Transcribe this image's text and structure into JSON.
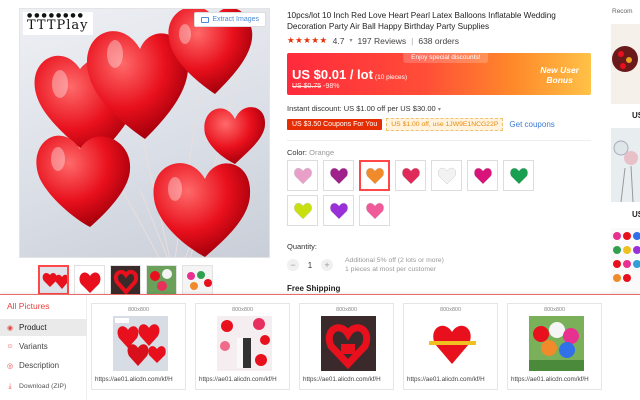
{
  "gallery": {
    "brand": "TTTPlay",
    "brand_dots": "●●●●●●●●",
    "extract_button": "Extract Images"
  },
  "product": {
    "title": "10pcs/lot 10 Inch Red Love Heart Pearl Latex Balloons Inflatable Wedding Decoration Party Air Ball Happy Birthday Party Supplies",
    "stars": "★★★★★",
    "rating": "4.7",
    "reviews": "197 Reviews",
    "orders": "638 orders"
  },
  "price": {
    "banner": "Enjoy special discounts!",
    "current": "US $0.01 / lot",
    "pieces": "(10 pieces)",
    "original": "US $0.75",
    "discount": "-98%",
    "new_user_line1": "New User",
    "new_user_line2": "Bonus"
  },
  "coupons": {
    "instant": "Instant discount: US $1.00 off per US $30.00",
    "red_coupon": "US $3.50 Coupons For You",
    "code_coupon": "US $1.00 off, use 1JW9E1NCG22P",
    "get_coupons": "Get coupons"
  },
  "color": {
    "label": "Color:",
    "selected": "Orange",
    "swatch_colors": [
      "#e8a0c8",
      "#a0208c",
      "#f08a2a",
      "#e02a5a",
      "#f2f2f2",
      "#d8147a",
      "#18a050",
      "#c8e010",
      "#9a30d8",
      "#f05a9a"
    ]
  },
  "quantity": {
    "label": "Quantity:",
    "minus": "−",
    "value": "1",
    "plus": "+",
    "note_line1": "Additional 5% off (2 lots or more)",
    "note_line2": "1 pieces at most per customer"
  },
  "shipping": {
    "label": "Free Shipping"
  },
  "sidebar": {
    "label": "Recom",
    "us_labels": [
      "US",
      "US"
    ]
  },
  "panel": {
    "title": "All Pictures",
    "nav": [
      {
        "label": "Product",
        "icon": "image-icon"
      },
      {
        "label": "Variants",
        "icon": "variants-icon"
      },
      {
        "label": "Description",
        "icon": "description-icon"
      },
      {
        "label": "Download (ZIP)",
        "icon": "download-icon"
      }
    ],
    "cards": [
      {
        "size": "800x800",
        "url": "https://ae01.alicdn.com/kf/H"
      },
      {
        "size": "800x800",
        "url": "https://ae01.alicdn.com/kf/H"
      },
      {
        "size": "800x800",
        "url": "https://ae01.alicdn.com/kf/H"
      },
      {
        "size": "800x800",
        "url": "https://ae01.alicdn.com/kf/H"
      },
      {
        "size": "800x800",
        "url": "https://ae01.alicdn.com/kf/H"
      }
    ]
  }
}
